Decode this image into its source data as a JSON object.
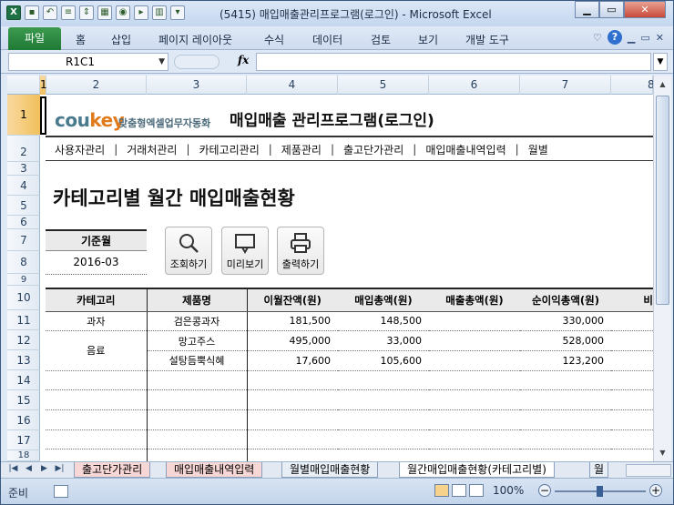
{
  "window": {
    "title": "(5415) 매입매출관리프로그램(로그인)  -  Microsoft Excel"
  },
  "ribbon": {
    "file_tab": "파일",
    "tabs": [
      "홈",
      "삽입",
      "페이지 레이아웃",
      "수식",
      "데이터",
      "검토",
      "보기",
      "개발 도구"
    ]
  },
  "formula_bar": {
    "name_box": "R1C1",
    "fx": "fx",
    "formula": ""
  },
  "grid": {
    "columns": [
      "1",
      "2",
      "3",
      "4",
      "5",
      "6",
      "7",
      "8"
    ],
    "rows": [
      "1",
      "2",
      "3",
      "4",
      "5",
      "6",
      "7",
      "8",
      "9",
      "10",
      "11",
      "12",
      "13",
      "14",
      "15",
      "16",
      "17",
      "18"
    ]
  },
  "app": {
    "logo_main": "cou",
    "logo_key": "key",
    "logo_sub": "맞춤형엑셀업무자동화",
    "title": "매입매출 관리프로그램(로그인)",
    "menu": [
      "사용자관리",
      "거래처관리",
      "카테고리관리",
      "제품관리",
      "출고단가관리",
      "매입매출내역입력",
      "월별"
    ],
    "page_title": "카테고리별 월간 매입매출현황",
    "base_month_label": "기준월",
    "base_month_value": "2016-03",
    "buttons": {
      "search": "조회하기",
      "preview": "미리보기",
      "print": "출력하기"
    }
  },
  "table": {
    "headers": [
      "카테고리",
      "제품명",
      "이월잔액(원)",
      "매입총액(원)",
      "매출총액(원)",
      "순이익총액(원)",
      "비"
    ],
    "rows": [
      [
        "과자",
        "검은콩과자",
        "181,500",
        "148,500",
        "",
        "330,000"
      ],
      [
        "음료",
        "망고주스",
        "495,000",
        "33,000",
        "",
        "528,000"
      ],
      [
        "",
        "설탕듬뿍식혜",
        "17,600",
        "105,600",
        "",
        "123,200"
      ],
      [
        "",
        "",
        "",
        "",
        "",
        ""
      ],
      [
        "",
        "",
        "",
        "",
        "",
        ""
      ],
      [
        "",
        "",
        "",
        "",
        "",
        ""
      ],
      [
        "",
        "",
        "",
        "",
        "",
        ""
      ],
      [
        "",
        "",
        "",
        "",
        "",
        ""
      ]
    ]
  },
  "sheet_tabs": [
    "출고단가관리",
    "매입매출내역입력",
    "월별매입매출현황",
    "월간매입매출현황(카테고리별)",
    "월"
  ],
  "status": {
    "ready": "준비",
    "zoom": "100%"
  }
}
